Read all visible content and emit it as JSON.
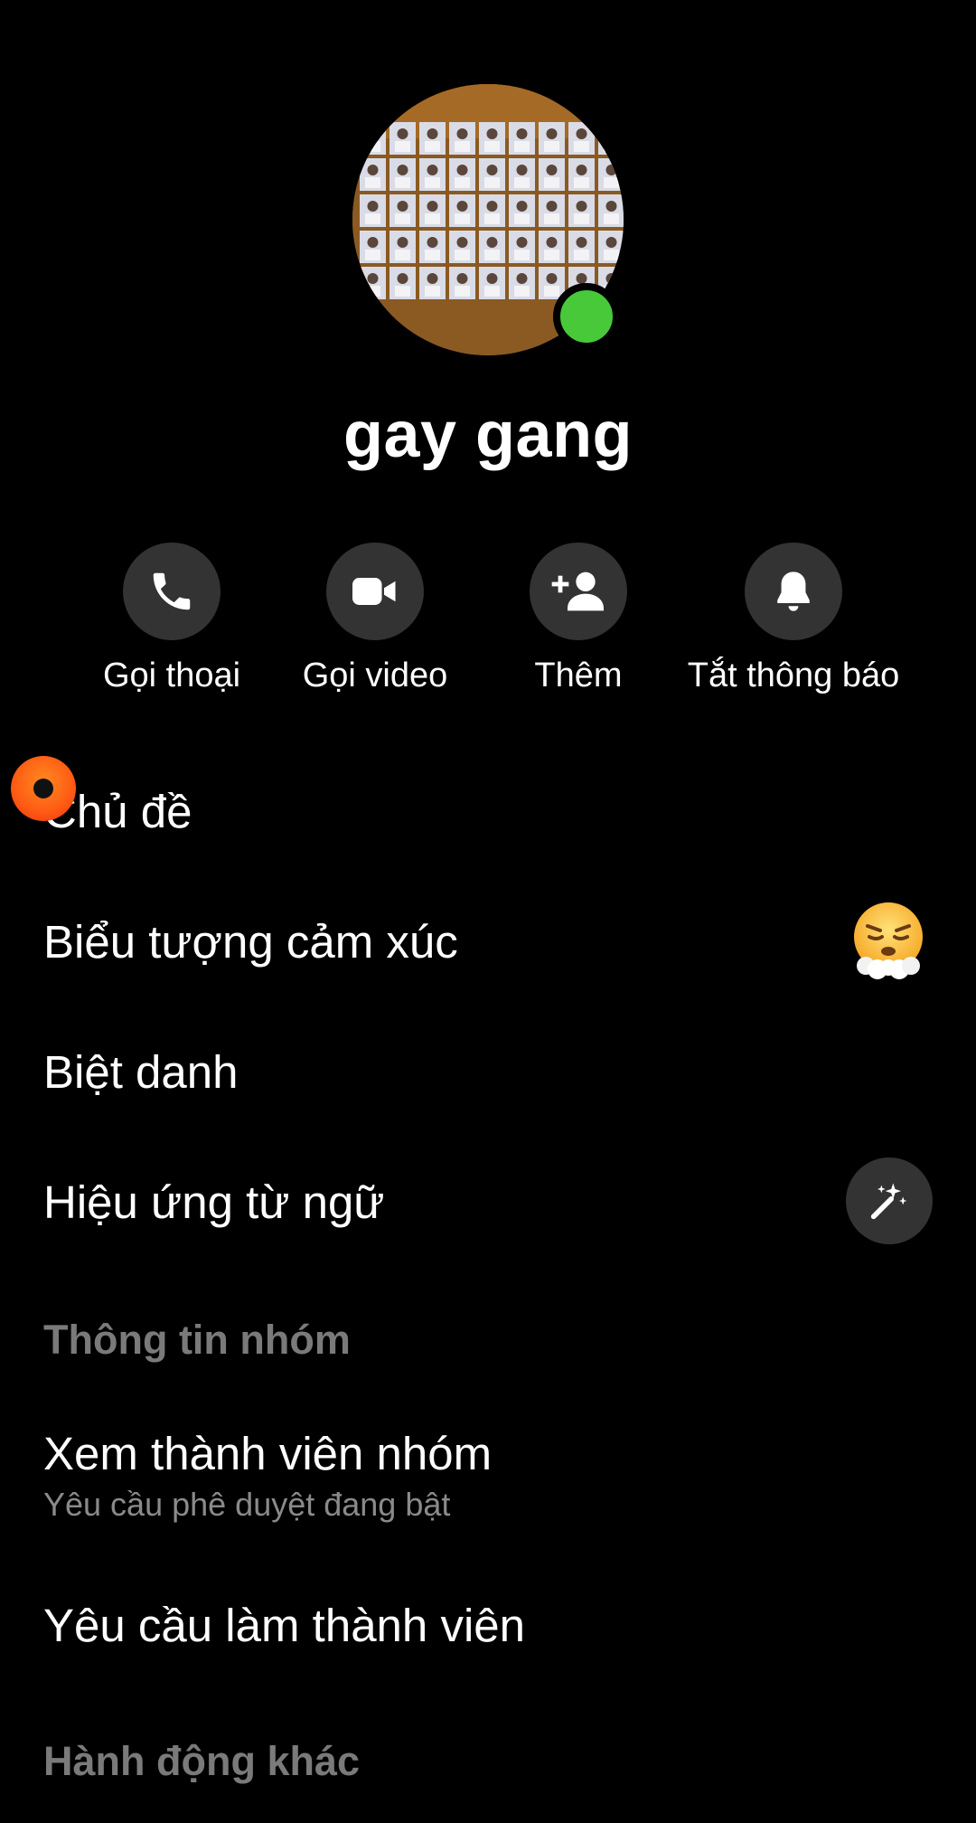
{
  "group": {
    "name": "gay gang"
  },
  "actions": [
    {
      "label": "Gọi thoại",
      "icon": "phone-icon"
    },
    {
      "label": "Gọi video",
      "icon": "video-camera-icon"
    },
    {
      "label": "Thêm",
      "icon": "add-person-icon"
    },
    {
      "label": "Tắt thông báo",
      "icon": "bell-icon"
    }
  ],
  "settings": {
    "theme": "Chủ đề",
    "emoji": "Biểu tượng cảm xúc",
    "nicknames": "Biệt danh",
    "word_effects": "Hiệu ứng từ ngữ"
  },
  "group_info": {
    "header": "Thông tin nhóm",
    "members_title": "Xem thành viên nhóm",
    "members_sub": "Yêu cầu phê duyệt đang bật",
    "requests_title": "Yêu cầu làm thành viên"
  },
  "other_actions": {
    "header": "Hành động khác"
  },
  "colors": {
    "background": "#000000",
    "online": "#47c93a",
    "button_bg": "#333333",
    "muted_text": "#8a8a8a"
  }
}
